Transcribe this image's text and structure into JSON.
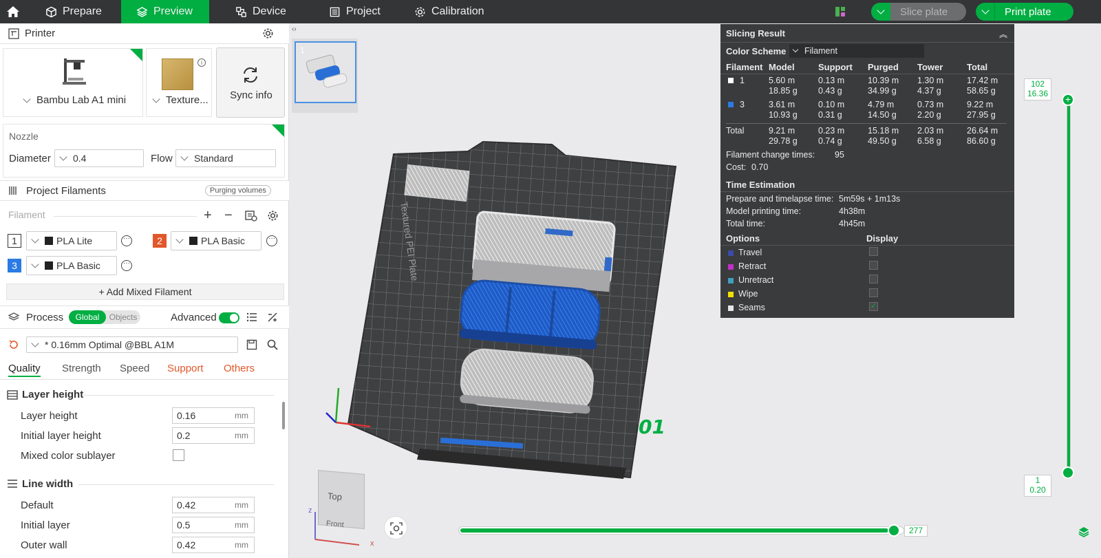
{
  "topbar": {
    "tabs": [
      {
        "label": "Prepare"
      },
      {
        "label": "Preview"
      },
      {
        "label": "Device"
      },
      {
        "label": "Project"
      },
      {
        "label": "Calibration"
      }
    ],
    "slice_label": "Slice plate",
    "print_label": "Print plate"
  },
  "printer": {
    "title": "Printer",
    "model": "Bambu Lab A1 mini",
    "plate": "Texture...",
    "sync_label": "Sync info"
  },
  "nozzle": {
    "title": "Nozzle",
    "diameter_label": "Diameter",
    "diameter": "0.4",
    "flow_label": "Flow",
    "flow": "Standard"
  },
  "filaments": {
    "title": "Project Filaments",
    "purge_label": "Purging volumes",
    "column_label": "Filament",
    "items": [
      {
        "num": "1",
        "name": "PLA Lite",
        "color": "#ffffff"
      },
      {
        "num": "2",
        "name": "PLA Basic",
        "color": "#e2572b"
      },
      {
        "num": "3",
        "name": "PLA Basic",
        "color": "#2a7be4"
      }
    ],
    "add_mixed": "+ Add Mixed Filament"
  },
  "process": {
    "title": "Process",
    "global_label": "Global",
    "objects_label": "Objects",
    "advanced_label": "Advanced",
    "preset": "* 0.16mm Optimal @BBL A1M",
    "tabs": [
      {
        "label": "Quality"
      },
      {
        "label": "Strength"
      },
      {
        "label": "Speed"
      },
      {
        "label": "Support"
      },
      {
        "label": "Others"
      }
    ],
    "groups": [
      {
        "title": "Layer height",
        "rows": [
          {
            "label": "Layer height",
            "value": "0.16",
            "unit": "mm"
          },
          {
            "label": "Initial layer height",
            "value": "0.2",
            "unit": "mm"
          },
          {
            "label": "Mixed color sublayer",
            "value": "",
            "unit": ""
          }
        ]
      },
      {
        "title": "Line width",
        "rows": [
          {
            "label": "Default",
            "value": "0.42",
            "unit": "mm"
          },
          {
            "label": "Initial layer",
            "value": "0.5",
            "unit": "mm"
          },
          {
            "label": "Outer wall",
            "value": "0.42",
            "unit": "mm"
          }
        ]
      }
    ]
  },
  "viewport": {
    "plate_number": "1",
    "plate_label": "01",
    "bed_text": "Textured PEI Plate",
    "view_top": "Top",
    "view_front": "Front",
    "axis_x": "x",
    "axis_z": "z",
    "layer_top_num": "102",
    "layer_top_z": "16.36",
    "layer_bottom_num": "1",
    "layer_bottom_z": "0.20",
    "move_value": "277"
  },
  "result": {
    "title": "Slicing Result",
    "color_scheme_label": "Color Scheme",
    "color_scheme": "Filament",
    "headers": [
      "Filament",
      "Model",
      "Support",
      "Purged",
      "Tower",
      "Total"
    ],
    "rows": [
      {
        "filament": "1",
        "color": "#ffffff",
        "model_m": "5.60 m",
        "model_g": "18.85 g",
        "support_m": "0.13 m",
        "support_g": "0.43 g",
        "purged_m": "10.39 m",
        "purged_g": "34.99 g",
        "tower_m": "1.30 m",
        "tower_g": "4.37 g",
        "total_m": "17.42 m",
        "total_g": "58.65 g"
      },
      {
        "filament": "3",
        "color": "#2a7be4",
        "model_m": "3.61 m",
        "model_g": "10.93 g",
        "support_m": "0.10 m",
        "support_g": "0.31 g",
        "purged_m": "4.79 m",
        "purged_g": "14.50 g",
        "tower_m": "0.73 m",
        "tower_g": "2.20 g",
        "total_m": "9.22 m",
        "total_g": "27.95 g"
      }
    ],
    "total": {
      "label": "Total",
      "model_m": "9.21 m",
      "model_g": "29.78 g",
      "support_m": "0.23 m",
      "support_g": "0.74 g",
      "purged_m": "15.18 m",
      "purged_g": "49.50 g",
      "tower_m": "2.03 m",
      "tower_g": "6.58 g",
      "total_m": "26.64 m",
      "total_g": "86.60 g"
    },
    "change_times_label": "Filament change times:",
    "change_times": "95",
    "cost_label": "Cost:",
    "cost": "0.70",
    "time_title": "Time Estimation",
    "prepare_label": "Prepare and timelapse time:",
    "prepare": "5m59s + 1m13s",
    "model_time_label": "Model printing time:",
    "model_time": "4h38m",
    "total_time_label": "Total time:",
    "total_time": "4h45m",
    "options_label": "Options",
    "display_label": "Display",
    "options": [
      {
        "label": "Travel",
        "color": "#3c4aa8",
        "checked": false
      },
      {
        "label": "Retract",
        "color": "#c22fc7",
        "checked": false
      },
      {
        "label": "Unretract",
        "color": "#3f9fbf",
        "checked": false
      },
      {
        "label": "Wipe",
        "color": "#f0e000",
        "checked": false
      },
      {
        "label": "Seams",
        "color": "#e6e6e6",
        "checked": true
      }
    ]
  }
}
